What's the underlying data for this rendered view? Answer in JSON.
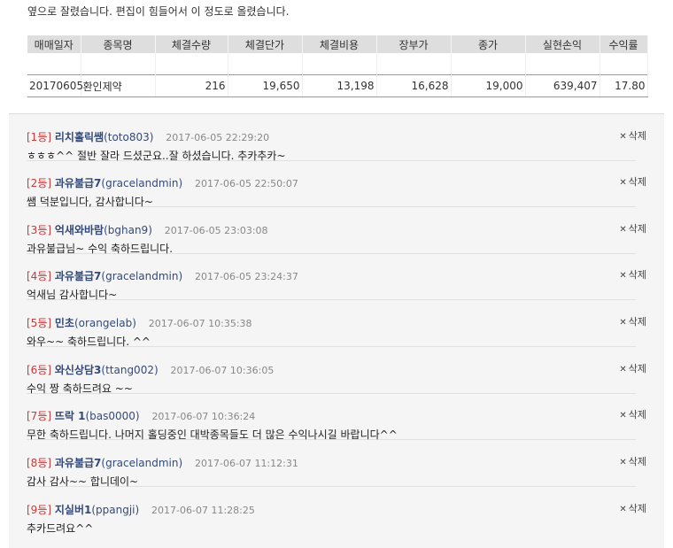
{
  "intro_text": "옆으로 잘렸습니다. 편집이 힘들어서 이 정도로 올렸습니다.",
  "trade_table": {
    "headers": [
      "매매일자",
      "종목명",
      "체결수량",
      "체결단가",
      "체결비용",
      "장부가",
      "종가",
      "실현손익",
      "수익률"
    ],
    "row": [
      "20170605",
      "환인제약",
      "216",
      "19,650",
      "13,198",
      "16,628",
      "19,000",
      "639,407",
      "17.80"
    ]
  },
  "comments": [
    {
      "rank": "[1등]",
      "nick": "리치홀릭쌤",
      "uid": "(toto803)",
      "date": "2017-06-05 22:29:20",
      "body": "ㅎㅎㅎ^^ 절반 잘라 드셨군요..잘 하셨습니다. 추카추카~",
      "delete": "삭제"
    },
    {
      "rank": "[2등]",
      "nick": "과유불급7",
      "uid": "(gracelandmin)",
      "date": "2017-06-05 22:50:07",
      "body": "쌤 덕분입니다, 감사합니다~",
      "delete": "삭제"
    },
    {
      "rank": "[3등]",
      "nick": "억새와바람",
      "uid": "(bghan9)",
      "date": "2017-06-05 23:03:08",
      "body": "과유불급님~ 수익 축하드립니다.",
      "delete": "삭제"
    },
    {
      "rank": "[4등]",
      "nick": "과유불급7",
      "uid": "(gracelandmin)",
      "date": "2017-06-05 23:24:37",
      "body": "억새님 감사합니다~",
      "delete": "삭제"
    },
    {
      "rank": "[5등]",
      "nick": "민초",
      "uid": "(orangelab)",
      "date": "2017-06-07 10:35:38",
      "body": "와우~~ 축하드립니다. ^^",
      "delete": "삭제"
    },
    {
      "rank": "[6등]",
      "nick": "와신상담3",
      "uid": "(ttang002)",
      "date": "2017-06-07 10:36:05",
      "body": "수익 짱 축하드려요 ~~",
      "delete": "삭제"
    },
    {
      "rank": "[7등]",
      "nick": "뜨락 1",
      "uid": "(bas0000)",
      "date": "2017-06-07 10:36:24",
      "body": "무한 축하드립니다. 나머지 홀딩중인 대박종목들도 더 많은 수익나시길 바랍니다^^",
      "delete": "삭제"
    },
    {
      "rank": "[8등]",
      "nick": "과유불급7",
      "uid": "(gracelandmin)",
      "date": "2017-06-07 11:12:31",
      "body": "감사 감사~~ 합니데이~",
      "delete": "삭제"
    },
    {
      "rank": "[9등]",
      "nick": "지실버1",
      "uid": "(ppangji)",
      "date": "2017-06-07 11:28:25",
      "body": "추카드려요^^",
      "delete": "삭제"
    }
  ]
}
